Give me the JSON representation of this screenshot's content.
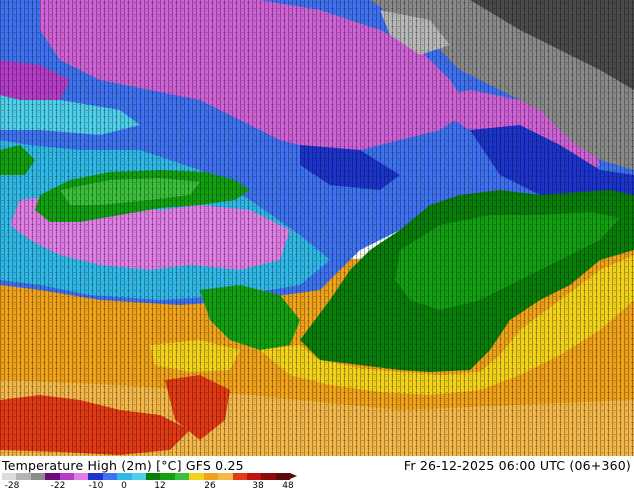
{
  "map": {
    "colors": {
      "deep_violet": "#b43cc6",
      "violet": "#cf62d6",
      "magenta_light": "#e07ee6",
      "blue_dark": "#1c34cc",
      "blue": "#3f72f0",
      "cyan": "#30b8e6",
      "cyan_light": "#4fd0ea",
      "green_dark": "#0a7e0a",
      "green": "#12a012",
      "green_light": "#3cc03c",
      "yellow": "#f2d21a",
      "orange": "#f0a21a",
      "orange_light": "#f4b84a",
      "red": "#e23a14",
      "gray_dark": "#4a4a4a",
      "gray": "#8a8a8a",
      "gray_light": "#b8b8b8"
    }
  },
  "footer": {
    "title": "Temperature High (2m) [°C] GFS 0.25",
    "datetime": "Fr 26-12-2025 06:00 UTC (06+360)",
    "colorbar": {
      "colors": [
        "#dcdcdc",
        "#b4b4b4",
        "#8c8c8c",
        "#6e0a7a",
        "#b43cc6",
        "#e07ee6",
        "#1c34cc",
        "#3f72f0",
        "#30b8e6",
        "#4fd0ea",
        "#0a7e0a",
        "#12a012",
        "#3cc03c",
        "#f2d21a",
        "#f0a21a",
        "#f4b84a",
        "#e23a14",
        "#c01010",
        "#8c0a0a",
        "#5a0a0a"
      ],
      "ticks": [
        "-28",
        "-22",
        "-10",
        "0",
        "12",
        "26",
        "38",
        "48"
      ]
    }
  }
}
